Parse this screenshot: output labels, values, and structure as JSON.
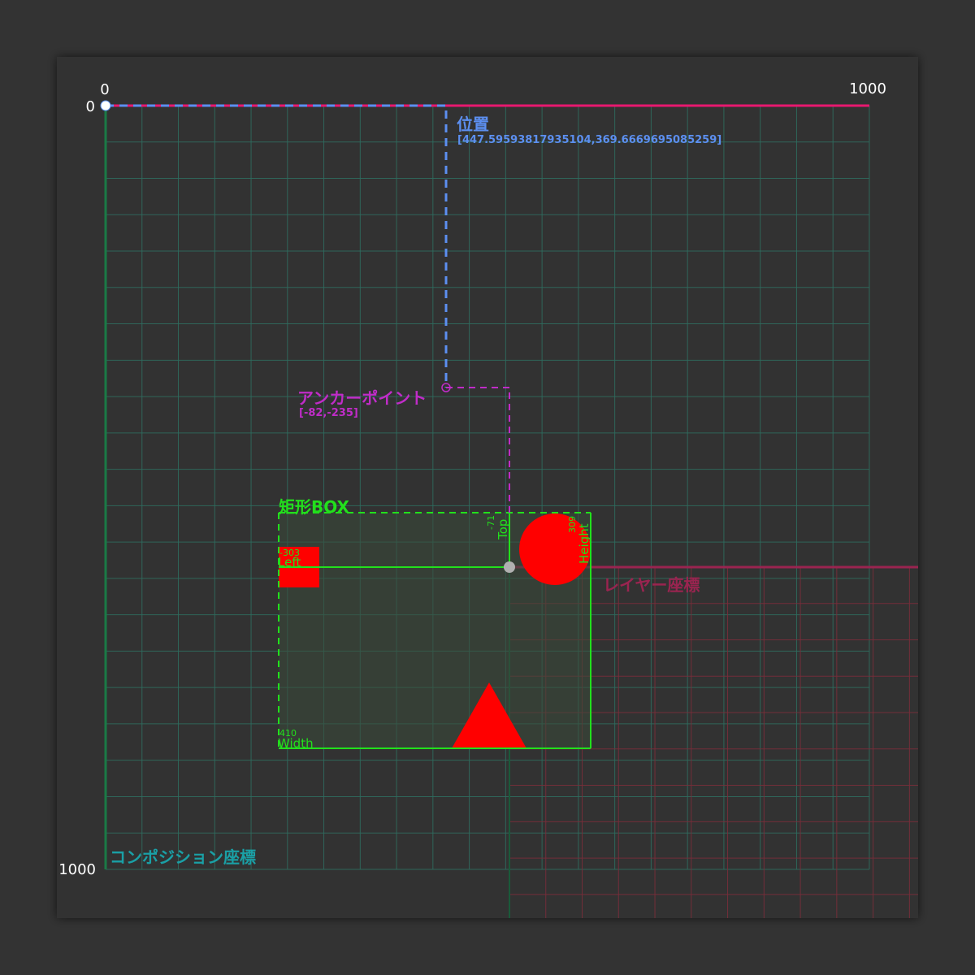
{
  "composition": {
    "label": "コンポジション座標",
    "axis_origin_x": "0",
    "axis_origin_y": "0",
    "axis_max_x": "1000",
    "axis_max_y": "1000",
    "grid_color": "#2f6b5e",
    "axis_x_color": "#e8186f",
    "axis_y_color": "#1a7a46",
    "label_color": "#1aa0a6"
  },
  "position": {
    "label": "位置",
    "value_text": "[447.59593817935104,369.6669695085259]",
    "value": [
      447.59593817935104,
      369.6669695085259
    ],
    "color": "#5c8ff0"
  },
  "anchor_point": {
    "label": "アンカーポイント",
    "value_text": "[-82,-235]",
    "value": [
      -82,
      -235
    ],
    "color": "#c02cc8"
  },
  "layer": {
    "label": "レイヤー座標",
    "grid_color": "#7a2e3a",
    "axis_color": "#9a2450"
  },
  "rect_box": {
    "label": "矩形BOX",
    "color": "#22e01c",
    "left_label": "Left",
    "left_value": "-303",
    "top_label": "Top",
    "top_value": "-71",
    "width_label": "Width",
    "width_value": "410",
    "height_label": "Height",
    "height_value": "309"
  },
  "shapes": {
    "color": "#ff0000"
  }
}
